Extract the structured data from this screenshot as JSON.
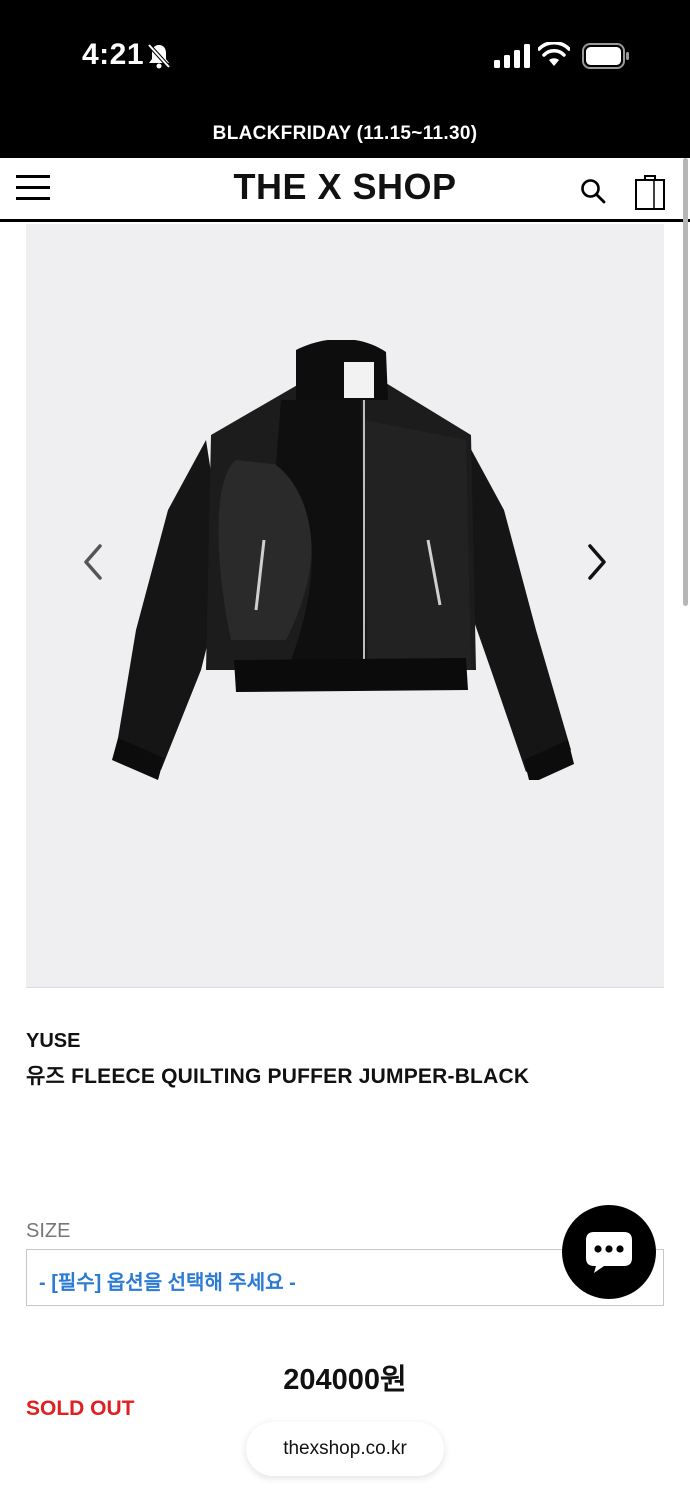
{
  "status_bar": {
    "time": "4:21"
  },
  "promo_banner": {
    "text": "BLACKFRIDAY (11.15~11.30)"
  },
  "header": {
    "logo": "THE X SHOP"
  },
  "product": {
    "brand": "YUSE",
    "name": "유즈 FLEECE QUILTING PUFFER JUMPER-BLACK",
    "size_label": "SIZE",
    "size_placeholder": "- [필수] 옵션을 선택해 주세요 -",
    "price": "204000원",
    "status": "SOLD OUT"
  },
  "browser": {
    "url": "thexshop.co.kr"
  },
  "icons": {
    "bell": "bell-slash-icon",
    "signal": "signal-icon",
    "wifi": "wifi-icon",
    "battery": "battery-icon",
    "menu": "hamburger-menu-icon",
    "search": "search-icon",
    "cart": "shopping-bag-icon",
    "prev": "chevron-left-icon",
    "next": "chevron-right-icon",
    "chat": "chat-bubble-icon"
  },
  "colors": {
    "accent_blue": "#2a7bd4",
    "sold_out_red": "#e02020",
    "image_background": "#efeff1"
  }
}
